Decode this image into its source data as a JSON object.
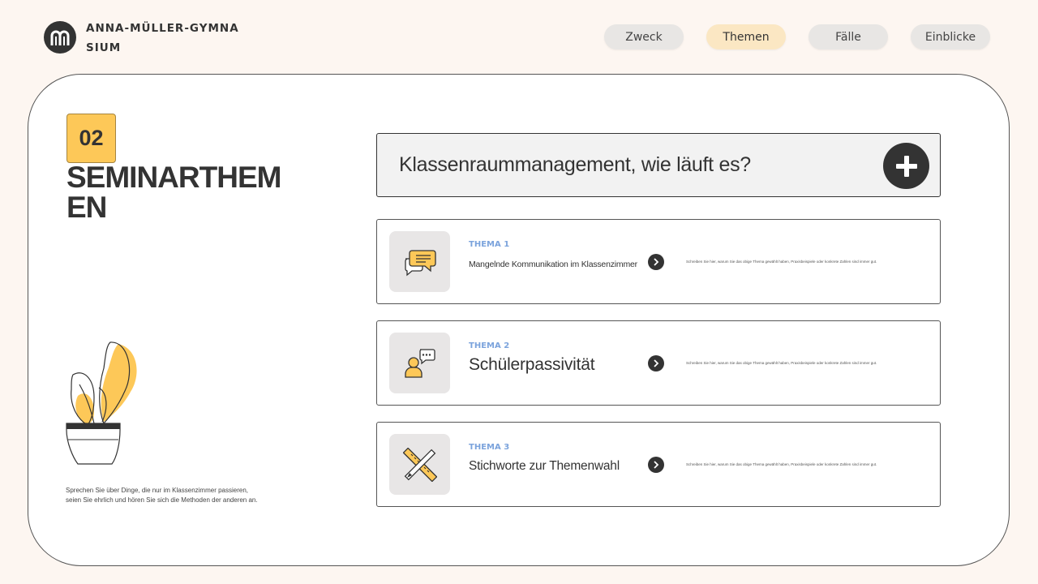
{
  "header": {
    "school_name": "ANNA-MÜLLER-GYMNASIUM",
    "nav": [
      {
        "label": "Zweck",
        "active": false
      },
      {
        "label": "Themen",
        "active": true
      },
      {
        "label": "Fälle",
        "active": false
      },
      {
        "label": "Einblicke",
        "active": false
      }
    ]
  },
  "section": {
    "number": "02",
    "title": "SEMINARTHEMEN",
    "caption_line1": "Sprechen Sie über Dinge, die nur im Klassenzimmer passieren,",
    "caption_line2": "seien Sie ehrlich und hören Sie sich die Methoden der anderen an."
  },
  "question": {
    "text": "Klassenraummanagement, wie läuft es?"
  },
  "topics": [
    {
      "label": "THEMA 1",
      "title": "Mangelnde Kommunikation im Klassenzimmer",
      "description": "Schreiben Sie hier, warum Sie das obige Thema gewählt haben, Praxisbeispiele oder konkrete Zahlen sind immer gut.",
      "icon": "chat-bubbles-icon"
    },
    {
      "label": "THEMA 2",
      "title": "Schülerpassivität",
      "description": "Schreiben Sie hier, warum Sie das obige Thema gewählt haben, Praxisbeispiele oder konkrete Zahlen sind immer gut.",
      "icon": "person-speech-icon"
    },
    {
      "label": "THEMA 3",
      "title": "Stichworte zur Themenwahl",
      "description": "Schreiben Sie hier, warum Sie das obige Thema gewählt haben, Praxisbeispiele oder konkrete Zahlen sind immer gut.",
      "icon": "ruler-pencil-icon"
    }
  ],
  "colors": {
    "accent_yellow": "#fdc858",
    "label_blue": "#7ba3dc",
    "dark": "#333333",
    "background": "#fdf6f1"
  }
}
